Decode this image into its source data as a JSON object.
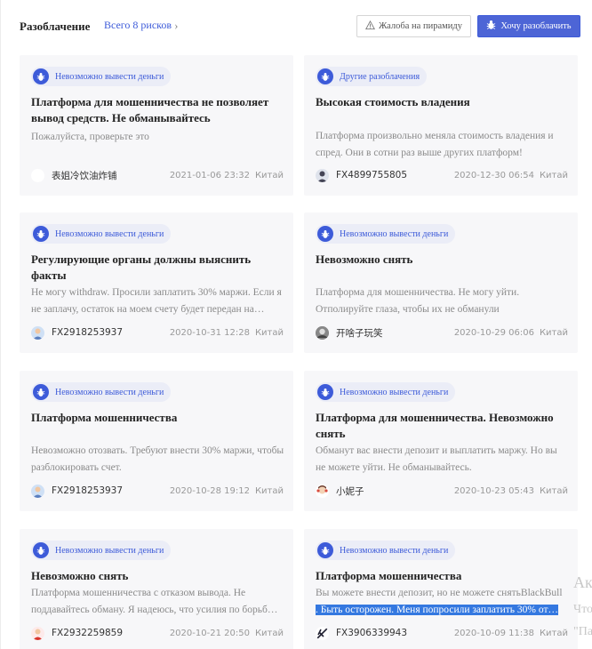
{
  "header": {
    "title": "Разоблачение",
    "count_link": "Всего 8 рисков",
    "complain_button": "Жалоба на пирамиду",
    "expose_button": "Хочу разоблачить"
  },
  "cards": [
    {
      "category": "Невозможно вывести деньги",
      "title": "Платформа для мошенничества не позволяет вывод средств. Не обманывайтесь",
      "body": "Пожалуйста, проверьте это",
      "author": "表姐冷饮油炸铺",
      "date": "2021-01-06 23:32",
      "region": "Китай"
    },
    {
      "category": "Другие разоблачения",
      "title": "Высокая стоимость владения",
      "body": "Платформа произвольно меняла стоимость владения и спред. Они в сотни раз выше других платформ!",
      "author": "FX4899755805",
      "date": "2020-12-30 06:54",
      "region": "Китай"
    },
    {
      "category": "Невозможно вывести деньги",
      "title": "Регулирующие органы должны выяснить факты",
      "body": "Не могу withdraw. Просили заплатить 30% маржи. Если я не заплачу, остаток на моем счету будет передан на…",
      "author": "FX2918253937",
      "date": "2020-10-31 12:28",
      "region": "Китай"
    },
    {
      "category": "Невозможно вывести деньги",
      "title": "Невозможно снять",
      "body": "Платформа для мошенничества. Не могу уйти. Отполируйте глаза, чтобы их не обманули",
      "author": "开啥子玩笑",
      "date": "2020-10-29 06:06",
      "region": "Китай"
    },
    {
      "category": "Невозможно вывести деньги",
      "title": "Платформа мошенничества",
      "body": "Невозможно отозвать. Требуют внести 30% маржи, чтобы разблокировать счет.",
      "author": "FX2918253937",
      "date": "2020-10-28 19:12",
      "region": "Китай"
    },
    {
      "category": "Невозможно вывести деньги",
      "title": "Платформа для мошенничества. Невозможно снять",
      "body": "Обманут вас внести депозит и выплатить маржу. Но вы не можете уйти. Не обманывайтесь.",
      "author": "小妮子",
      "date": "2020-10-23 05:43",
      "region": "Китай"
    },
    {
      "category": "Невозможно вывести деньги",
      "title": "Невозможно снять",
      "body": "Платформа мошенничества с отказом вывода. Не поддавайтесь обману. Я надеюсь, что усилия по борьб…",
      "author": "FX2932259859",
      "date": "2020-10-21 20:50",
      "region": "Китай"
    },
    {
      "category": "Невозможно вывести деньги",
      "title": "Платформа мошенничества",
      "body": "Вы можете внести депозит, но не можете снятьBlackBull",
      "body_selected": ". Быть осторожен. Меня попросили заплатить 30% от…",
      "author": "FX3906339943",
      "date": "2020-10-09 11:38",
      "region": "Китай"
    }
  ],
  "overlay": {
    "line1": "Ак",
    "line2": "Что",
    "line3": "\"Па"
  },
  "colors": {
    "accent": "#3d5bd9",
    "card_bg": "#f7f7f9",
    "selection": "#3478e0"
  }
}
